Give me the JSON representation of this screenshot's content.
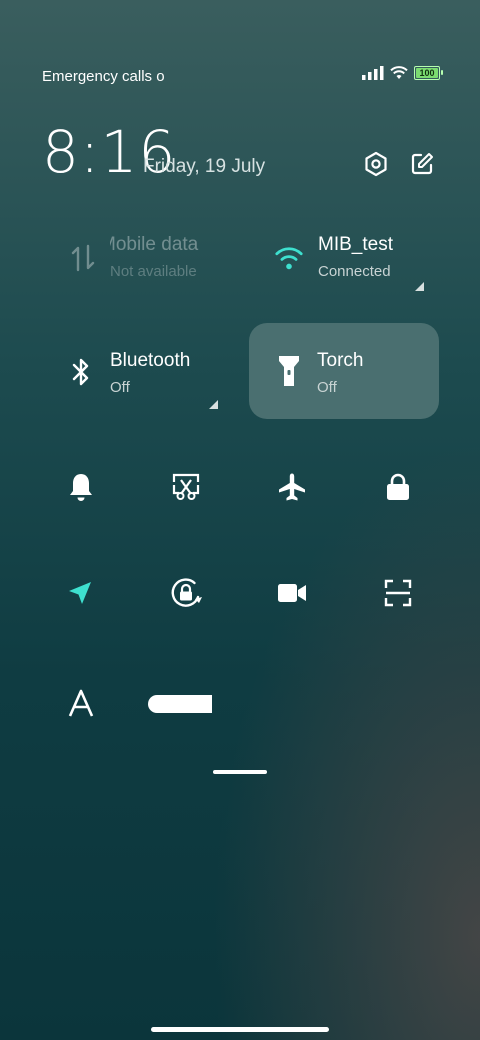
{
  "status_bar": {
    "carrier_text": "Emergency calls o",
    "battery_level": "100",
    "battery_fraction": 1.0
  },
  "header": {
    "time": "8:16",
    "date": "Friday, 19 July",
    "settings_icon": "hexagon-settings-icon",
    "edit_icon": "edit-icon"
  },
  "tiles": {
    "mobile_data": {
      "title": "Mobile data",
      "status": "Not available",
      "icon": "arrows-up-down-icon"
    },
    "wifi": {
      "title": "MIB_test",
      "status": "Connected",
      "icon": "wifi-icon"
    },
    "bluetooth": {
      "title": "Bluetooth",
      "status": "Off",
      "icon": "bluetooth-icon"
    },
    "torch": {
      "title": "Torch",
      "status": "Off",
      "icon": "torch-icon"
    }
  },
  "toggles": [
    "bell-icon",
    "screenshot-icon",
    "airplane-icon",
    "lock-icon",
    "location-icon",
    "rotation-lock-icon",
    "video-camera-icon",
    "scanner-icon",
    "font-icon"
  ],
  "colors": {
    "accent": "#3ee0cf",
    "active_tile": "#4a6f70"
  }
}
